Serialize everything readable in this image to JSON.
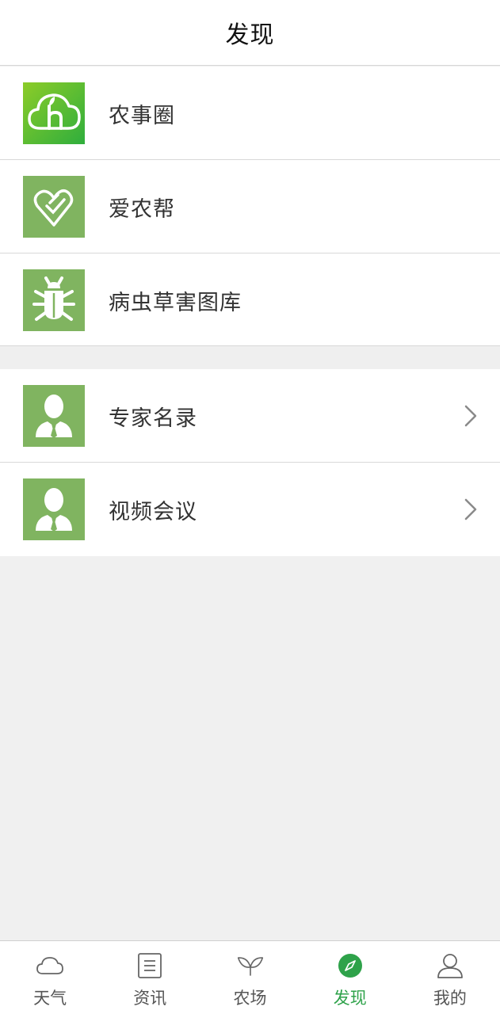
{
  "header": {
    "title": "发现"
  },
  "section1": {
    "items": [
      {
        "label": "农事圈",
        "icon": "cloud-h-icon"
      },
      {
        "label": "爱农帮",
        "icon": "heart-hand-icon"
      },
      {
        "label": "病虫草害图库",
        "icon": "bug-icon"
      }
    ]
  },
  "section2": {
    "items": [
      {
        "label": "专家名录",
        "icon": "expert-person-icon"
      },
      {
        "label": "视频会议",
        "icon": "expert-person-icon"
      }
    ]
  },
  "tabbar": {
    "tabs": [
      {
        "label": "天气",
        "icon": "cloud-icon",
        "active": false
      },
      {
        "label": "资讯",
        "icon": "news-list-icon",
        "active": false
      },
      {
        "label": "农场",
        "icon": "sprout-icon",
        "active": false
      },
      {
        "label": "发现",
        "icon": "compass-icon",
        "active": true
      },
      {
        "label": "我的",
        "icon": "user-icon",
        "active": false
      }
    ]
  },
  "colors": {
    "accent": "#2ea24a",
    "icon_bg": "#80b460",
    "icon_gradient": [
      "#8ccc28",
      "#2fae3d"
    ],
    "background": "#f0f0f0"
  }
}
